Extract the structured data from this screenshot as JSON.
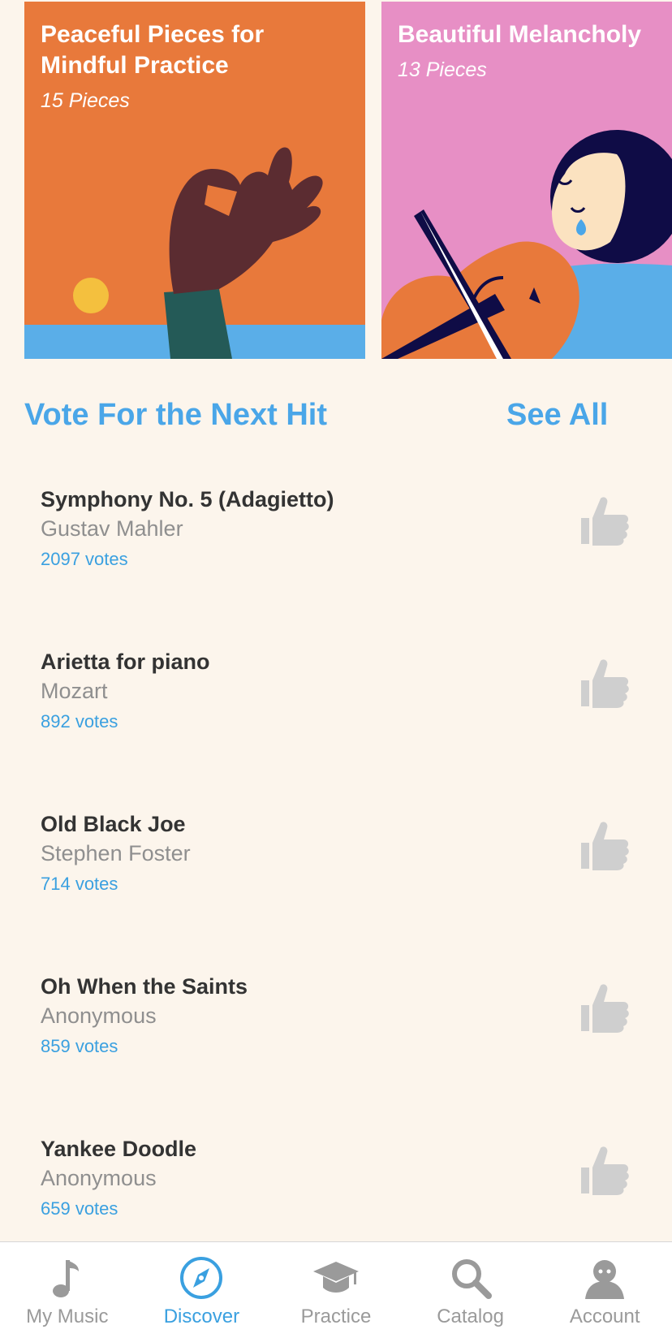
{
  "carousel": {
    "cards": [
      {
        "title": "Peaceful Pieces for Mindful Practice",
        "count": "15 Pieces",
        "bg": "#e8793b"
      },
      {
        "title": "Beautiful Melancholy",
        "count": "13 Pieces",
        "bg": "#e78fc5"
      }
    ]
  },
  "section": {
    "title": "Vote For the Next Hit",
    "see_all": "See All"
  },
  "vote_items": [
    {
      "name": "Symphony No. 5 (Adagietto)",
      "artist": "Gustav Mahler",
      "votes": "2097 votes"
    },
    {
      "name": "Arietta for piano",
      "artist": "Mozart",
      "votes": "892 votes"
    },
    {
      "name": "Old Black Joe",
      "artist": "Stephen Foster",
      "votes": "714 votes"
    },
    {
      "name": "Oh When the Saints",
      "artist": "Anonymous",
      "votes": "859 votes"
    },
    {
      "name": "Yankee Doodle",
      "artist": "Anonymous",
      "votes": "659 votes"
    }
  ],
  "tabbar": {
    "tabs": [
      {
        "label": "My Music",
        "icon": "music-note-icon",
        "active": false
      },
      {
        "label": "Discover",
        "icon": "compass-icon",
        "active": true
      },
      {
        "label": "Practice",
        "icon": "graduation-cap-icon",
        "active": false
      },
      {
        "label": "Catalog",
        "icon": "search-icon",
        "active": false
      },
      {
        "label": "Account",
        "icon": "user-icon",
        "active": false
      }
    ]
  },
  "colors": {
    "accent": "#3aa0e0",
    "background": "#fcf5ec",
    "thumb_inactive": "#cfcfcf"
  }
}
